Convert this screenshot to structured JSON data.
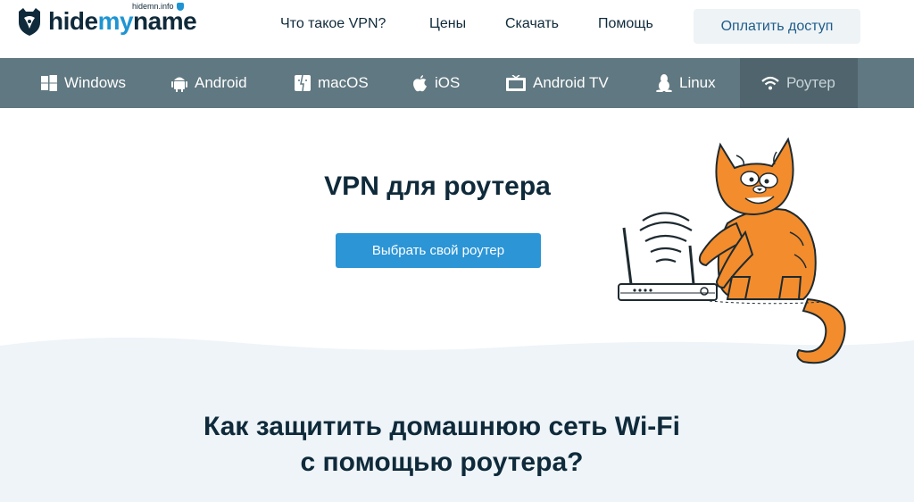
{
  "header": {
    "logo_text_prefix": "hide",
    "logo_text_accent": "my",
    "logo_text_suffix": "name",
    "domain_label": "hidemn.info",
    "nav": [
      {
        "label": "Что такое VPN?"
      },
      {
        "label": "Цены"
      },
      {
        "label": "Скачать"
      },
      {
        "label": "Помощь"
      }
    ],
    "pay_label": "Оплатить доступ"
  },
  "platforms": [
    {
      "label": "Windows",
      "icon": "windows-icon"
    },
    {
      "label": "Android",
      "icon": "android-icon"
    },
    {
      "label": "macOS",
      "icon": "finder-icon"
    },
    {
      "label": "iOS",
      "icon": "apple-icon"
    },
    {
      "label": "Android TV",
      "icon": "tv-icon"
    },
    {
      "label": "Linux",
      "icon": "linux-icon"
    },
    {
      "label": "Роутер",
      "icon": "wifi-icon",
      "active": true
    }
  ],
  "hero": {
    "title": "VPN для роутера",
    "button_label": "Выбрать свой роутер"
  },
  "section": {
    "title_line1": "Как защитить домашнюю сеть Wi-Fi",
    "title_line2": "с помощью роутера?"
  },
  "colors": {
    "accent": "#2b95d6",
    "platform_bar": "#607881",
    "platform_active": "#4f646c",
    "text_dark": "#0f2a3a",
    "section_bg": "#eef4f8",
    "cat_orange": "#f28c2c"
  }
}
